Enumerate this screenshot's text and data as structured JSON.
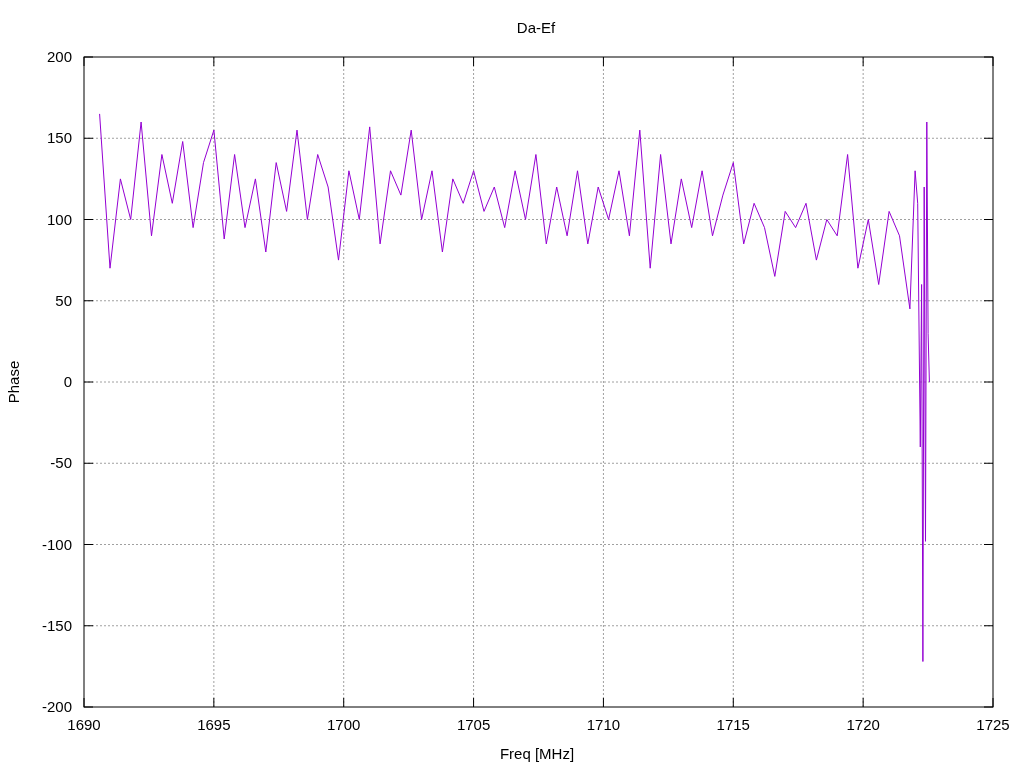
{
  "chart_data": {
    "type": "line",
    "title": "Da-Ef",
    "xlabel": "Freq [MHz]",
    "ylabel": "Phase",
    "grid": true,
    "xlim": [
      1690,
      1725
    ],
    "ylim": [
      -200,
      200
    ],
    "xticks": [
      1690,
      1695,
      1700,
      1705,
      1710,
      1715,
      1720,
      1725
    ],
    "yticks": [
      -200,
      -150,
      -100,
      -50,
      0,
      50,
      100,
      150,
      200
    ],
    "x": [
      1690.6,
      1691.0,
      1691.4,
      1691.8,
      1692.2,
      1692.6,
      1693.0,
      1693.4,
      1693.8,
      1694.2,
      1694.6,
      1695.0,
      1695.4,
      1695.8,
      1696.2,
      1696.6,
      1697.0,
      1697.4,
      1697.8,
      1698.2,
      1698.6,
      1699.0,
      1699.4,
      1699.8,
      1700.2,
      1700.6,
      1701.0,
      1701.4,
      1701.8,
      1702.2,
      1702.6,
      1703.0,
      1703.4,
      1703.8,
      1704.2,
      1704.6,
      1705.0,
      1705.4,
      1705.8,
      1706.2,
      1706.6,
      1707.0,
      1707.4,
      1707.8,
      1708.2,
      1708.6,
      1709.0,
      1709.4,
      1709.8,
      1710.2,
      1710.6,
      1711.0,
      1711.4,
      1711.8,
      1712.2,
      1712.6,
      1713.0,
      1713.4,
      1713.8,
      1714.2,
      1714.6,
      1715.0,
      1715.4,
      1715.8,
      1716.2,
      1716.6,
      1717.0,
      1717.4,
      1717.8,
      1718.2,
      1718.6,
      1719.0,
      1719.4,
      1719.8,
      1720.2,
      1720.6,
      1721.0,
      1721.4,
      1721.8,
      1722.0,
      1722.1,
      1722.2,
      1722.25,
      1722.3,
      1722.35,
      1722.4,
      1722.45,
      1722.5,
      1722.55
    ],
    "series": [
      {
        "color": "#9400d3",
        "values": [
          165,
          70,
          125,
          100,
          160,
          90,
          140,
          110,
          148,
          95,
          135,
          155,
          88,
          140,
          95,
          125,
          80,
          135,
          105,
          155,
          100,
          140,
          120,
          75,
          130,
          100,
          157,
          85,
          130,
          115,
          155,
          100,
          130,
          80,
          125,
          110,
          130,
          105,
          120,
          95,
          130,
          100,
          140,
          85,
          120,
          90,
          130,
          85,
          120,
          100,
          130,
          90,
          155,
          70,
          140,
          85,
          125,
          95,
          130,
          90,
          115,
          135,
          85,
          110,
          95,
          65,
          105,
          95,
          110,
          75,
          100,
          90,
          140,
          70,
          100,
          60,
          105,
          90,
          45,
          130,
          110,
          -40,
          60,
          -172,
          120,
          -98,
          160,
          30,
          0
        ]
      }
    ]
  }
}
